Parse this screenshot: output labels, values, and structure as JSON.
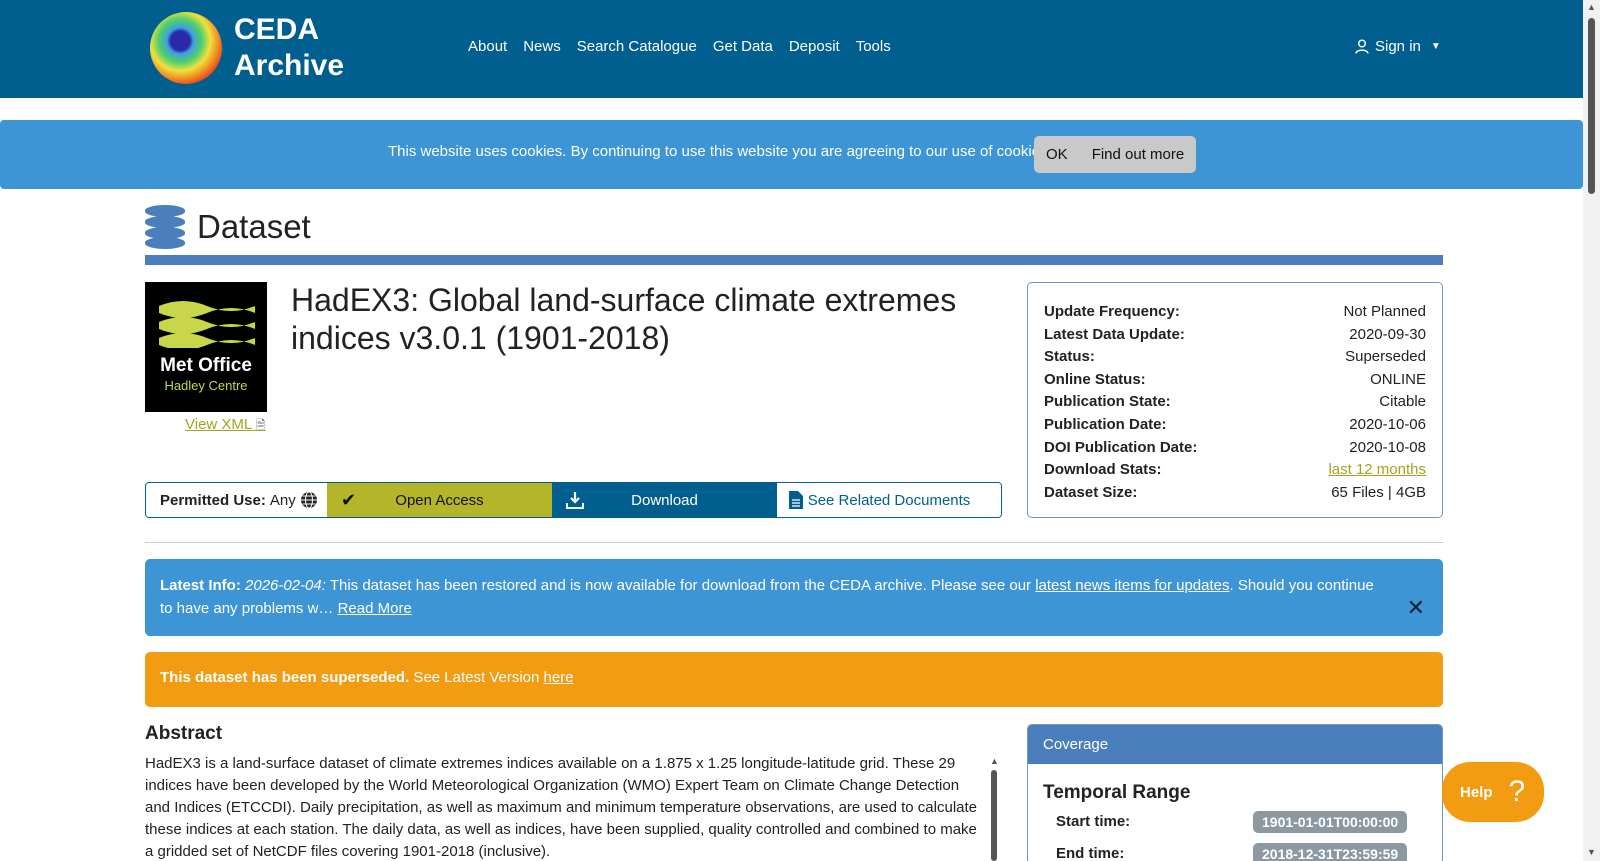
{
  "navbar": {
    "logo_line1": "CEDA",
    "logo_line2": "Archive",
    "links": [
      "About",
      "News",
      "Search Catalogue",
      "Get Data",
      "Deposit",
      "Tools"
    ],
    "signin": "Sign in"
  },
  "cookie": {
    "text": "This website uses cookies. By continuing to use this website you are agreeing to our use of cookies.",
    "ok": "OK",
    "find_out": "Find out more"
  },
  "heading": "Dataset",
  "dataset": {
    "title": "HadEX3: Global land-surface climate extremes indices v3.0.1 (1901-2018)",
    "logo_name": "Met Office",
    "logo_sub": "Hadley Centre",
    "view_xml": "View XML"
  },
  "actions": {
    "permitted_label": "Permitted Use:",
    "permitted_value": "Any",
    "open_access": "Open Access",
    "download": "Download",
    "related_docs": "See Related Documents"
  },
  "info": [
    {
      "k": "Update Frequency:",
      "v": "Not Planned"
    },
    {
      "k": "Latest Data Update:",
      "v": "2020-09-30"
    },
    {
      "k": "Status:",
      "v": "Superseded"
    },
    {
      "k": "Online Status:",
      "v": "ONLINE"
    },
    {
      "k": "Publication State:",
      "v": "Citable"
    },
    {
      "k": "Publication Date:",
      "v": "2020-10-06"
    },
    {
      "k": "DOI Publication Date:",
      "v": "2020-10-08"
    },
    {
      "k": "Download Stats:",
      "v": "last 12 months"
    },
    {
      "k": "Dataset Size:",
      "v": "65 Files | 4GB"
    }
  ],
  "latest": {
    "label": "Latest Info:",
    "date": "2026-02-04:",
    "text1": " This dataset has been restored and is now available for download from the CEDA archive. Please see our ",
    "link": "latest news items for updates",
    "text2": ". Should you continue to have any problems w… ",
    "read_more": "Read More"
  },
  "superseded": {
    "bold": "This dataset has been superseded.",
    "text": " See Latest Version ",
    "link": "here"
  },
  "abstract": {
    "heading": "Abstract",
    "body": "HadEX3 is a land-surface dataset of climate extremes indices available on a 1.875 x 1.25 longitude-latitude grid. These 29 indices have been developed by the World Meteorological Organization (WMO) Expert Team on Climate Change Detection and Indices (ETCCDI). Daily precipitation, as well as maximum and minimum temperature observations, are used to calculate these indices at each station. The daily data, as well as indices, have been supplied, quality controlled and combined to make a gridded set of NetCDF files covering 1901-2018 (inclusive)."
  },
  "coverage": {
    "heading": "Coverage",
    "temporal": "Temporal Range",
    "start_label": "Start time:",
    "start_value": "1901-01-01T00:00:00",
    "end_label": "End time:",
    "end_value": "2018-12-31T23:59:59"
  },
  "help": {
    "label": "Help",
    "icon": "?"
  },
  "colors": {
    "navbar": "#005f8f",
    "cookie": "#3d95d6",
    "accent": "#4a7ebd",
    "open_access": "#b5b52a",
    "warning": "#f39c12"
  }
}
